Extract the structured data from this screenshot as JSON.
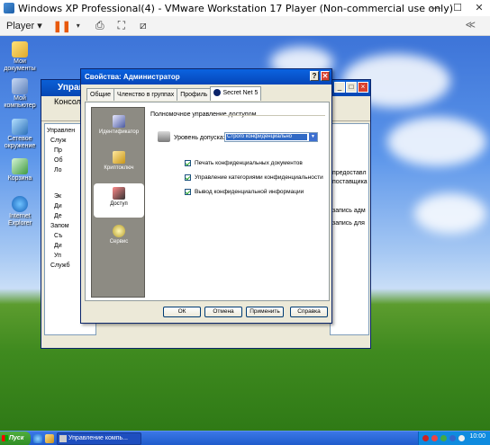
{
  "vm": {
    "title": "Windows XP Professional(4) - VMware Workstation 17 Player (Non-commercial use only)",
    "minimize": "—",
    "maximize": "☐",
    "close": "✕",
    "player_menu": "Player ▾",
    "right_button": "≪"
  },
  "desktop": {
    "icons": [
      "Мои документы",
      "Мой компьютер",
      "Сетевое окружение",
      "Корзина",
      "Internet Explorer"
    ]
  },
  "mmc": {
    "title": "Управ",
    "menu": "Консоль",
    "tree": [
      "Управлен",
      "Служ",
      "Пр",
      "Об",
      "Ло",
      "Эк",
      "Ди",
      "Де",
      "Запом",
      "Съ",
      "Ди",
      "Уп",
      "Служб"
    ],
    "right": [
      "предоставл",
      "поставщика",
      "запись адм",
      "запись для"
    ]
  },
  "dialog": {
    "title": "Свойства: Администратор",
    "help_btn": "?",
    "close_btn": "✕",
    "tabs": [
      "Общие",
      "Членство в группах",
      "Профиль",
      "Secret Net 5"
    ],
    "categories": [
      "Идентификатор",
      "Криптоключ",
      "Доступ",
      "Сервис"
    ],
    "group_label": "Полномочное управление доступом",
    "level_label": "Уровень допуска:",
    "level_value": "Строго конфиденциально",
    "checks": [
      {
        "label": "Печать конфиденциальных документов",
        "checked": true
      },
      {
        "label": "Управление категориями конфиденциальности",
        "checked": true
      },
      {
        "label": "Вывод конфиденциальной информации",
        "checked": true
      }
    ],
    "buttons": [
      "ОК",
      "Отмена",
      "Применить",
      "Справка"
    ]
  },
  "taskbar": {
    "start": "Пуск",
    "task": "Управление компь...",
    "clock": "10:00"
  }
}
